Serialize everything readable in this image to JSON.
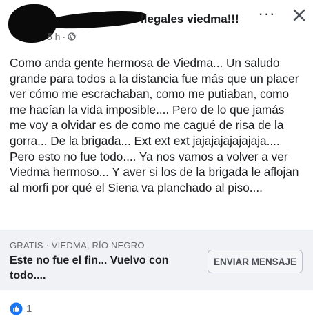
{
  "post": {
    "group_name": "llegales viedma!!!",
    "time": "5 h",
    "separator": "·",
    "privacy_icon": "globe-icon",
    "text": "Como anda gente hermosa de Viedma... Un saludo grande para todos a la distancia fue más que un placer ver cómo me escrachaban, como me putiaban, como me hacían la vida imposible.... Pero de lo que jamás me voy a olvidar es de como me cagué de risa de la gorra... De la brigada... Ext ext ext jajajajajajajaja.... Pero esto no fue todo.... Ya nos vamos a volver a ver Viedma hermoso... Y aver si los de la brigada le aflojan al morfi por qué el Siena va planchado al piso...."
  },
  "header_actions": {
    "more_label": "···",
    "more_icon": "more-dots-icon",
    "close_icon": "close-icon"
  },
  "listing": {
    "meta": "GRATIS · VIEDMA, RÍO NEGRO",
    "title": "Este no fue el fin... Vuelvo con todo....",
    "send_button": "ENVIAR MENSAJE"
  },
  "reactions": {
    "icon": "like-icon",
    "count": "1"
  },
  "colors": {
    "text": "#1c1e21",
    "secondary": "#65676b",
    "listing_bg": "#f0f2f5",
    "like_blue": "#1877f2"
  }
}
